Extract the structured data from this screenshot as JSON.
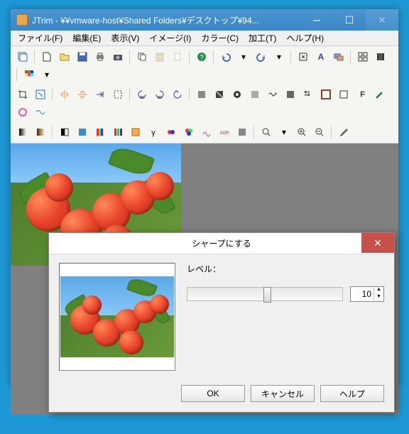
{
  "main_window": {
    "title": "JTrim - ¥¥vmware-host¥Shared Folders¥デスクトップ¥94..."
  },
  "menubar": {
    "file": "ファイル(F)",
    "edit": "編集(E)",
    "view": "表示(V)",
    "image": "イメージ(I)",
    "color": "カラー(C)",
    "effect": "加工(T)",
    "help": "ヘルプ(H)"
  },
  "dialog": {
    "title": "シャープにする",
    "level_label": "レベル：",
    "level_value": "10",
    "ok": "OK",
    "cancel": "キャンセル",
    "help": "ヘルプ"
  },
  "icons": {
    "minimize": "─",
    "maximize": "☐",
    "close": "✕"
  }
}
